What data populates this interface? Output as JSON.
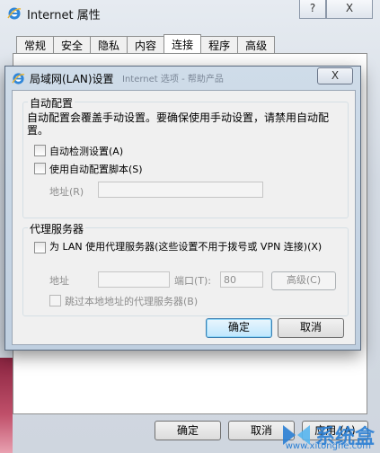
{
  "bg_window": {
    "title": "Internet 属性",
    "help_button": "?",
    "close_button": "X",
    "tabs": [
      "常规",
      "安全",
      "隐私",
      "内容",
      "连接",
      "程序",
      "高级"
    ],
    "active_tab": "连接",
    "buttons": {
      "ok": "确定",
      "cancel": "取消",
      "apply": "应用 (A)"
    }
  },
  "watermark": {
    "name": "系统盒",
    "url": "www.xitonghe.com"
  },
  "lan_dialog": {
    "title": "局域网(LAN)设置",
    "ghost_title": "Internet 选项 - 帮助产品",
    "close_button": "X",
    "auto_config": {
      "label": "自动配置",
      "description": "自动配置会覆盖手动设置。要确保使用手动设置，请禁用自动配置。",
      "auto_detect": "自动检测设置(A)",
      "use_script": "使用自动配置脚本(S)",
      "address_label": "地址(R)",
      "address_value": ""
    },
    "proxy": {
      "label": "代理服务器",
      "use_proxy": "为 LAN 使用代理服务器(这些设置不用于拨号或 VPN 连接)(X)",
      "address_label": "地址",
      "address_value": "",
      "port_label": "端口(T):",
      "port_value": "80",
      "advanced_button": "高级(C)",
      "bypass_local": "跳过本地地址的代理服务器(B)"
    },
    "ok_button": "确定",
    "cancel_button": "取消"
  }
}
